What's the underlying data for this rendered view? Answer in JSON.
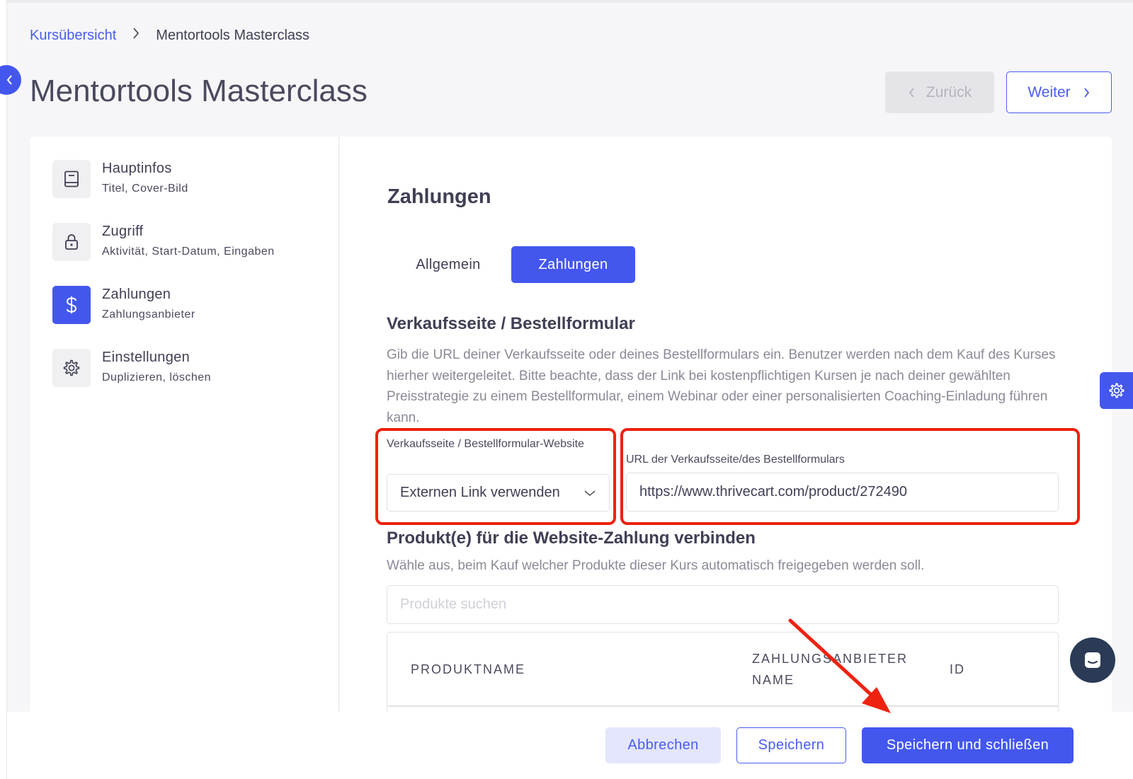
{
  "breadcrumb": {
    "parent": "Kursübersicht",
    "separator": ">",
    "current": "Mentortools Masterclass"
  },
  "page": {
    "title": "Mentortools Masterclass"
  },
  "nav_buttons": {
    "prev_label": "Zurück",
    "next_label": "Weiter"
  },
  "sidebar": {
    "items": [
      {
        "title": "Hauptinfos",
        "subtitle": "Titel, Cover-Bild",
        "icon": "book-icon",
        "active": false
      },
      {
        "title": "Zugriff",
        "subtitle": "Aktivität, Start-Datum, Eingaben",
        "icon": "lock-icon",
        "active": false
      },
      {
        "title": "Zahlungen",
        "subtitle": "Zahlungsanbieter",
        "icon": "dollar-icon",
        "active": true
      },
      {
        "title": "Einstellungen",
        "subtitle": "Duplizieren, löschen",
        "icon": "gear-icon",
        "active": false
      }
    ]
  },
  "main": {
    "section_title": "Zahlungen",
    "tabs": [
      {
        "label": "Allgemein",
        "active": false
      },
      {
        "label": "Zahlungen",
        "active": true
      }
    ],
    "sales_page": {
      "heading": "Verkaufsseite / Bestellformular",
      "description": "Gib die URL deiner Verkaufsseite oder deines Bestellformulars ein. Benutzer werden nach dem Kauf des Kurses hierher weitergeleitet. Bitte beachte, dass der Link bei kostenpflichtigen Kursen je nach deiner gewählten Preisstrategie zu einem Bestellformular, einem Webinar oder einer personalisierten Coaching-Einladung führen kann.",
      "select_label": "Verkaufsseite / Bestellformular-Website",
      "select_value": "Externen Link verwenden",
      "url_label": "URL der Verkaufsseite/des Bestellformulars",
      "url_value": "https://www.thrivecart.com/product/272490"
    },
    "products": {
      "heading": "Produkt(e) für die Website-Zahlung verbinden",
      "description": "Wähle aus, beim Kauf welcher Produkte dieser Kurs automatisch freigegeben werden soll.",
      "search_placeholder": "Produkte suchen",
      "columns": [
        "PRODUKTNAME",
        "ZAHLUNGSANBIETER NAME",
        "ID"
      ]
    }
  },
  "footer": {
    "cancel_label": "Abbrechen",
    "save_label": "Speichern",
    "save_close_label": "Speichern und schließen"
  },
  "colors": {
    "accent": "#4357ee",
    "highlight": "#ee2211",
    "chat": "#2b3a55"
  }
}
